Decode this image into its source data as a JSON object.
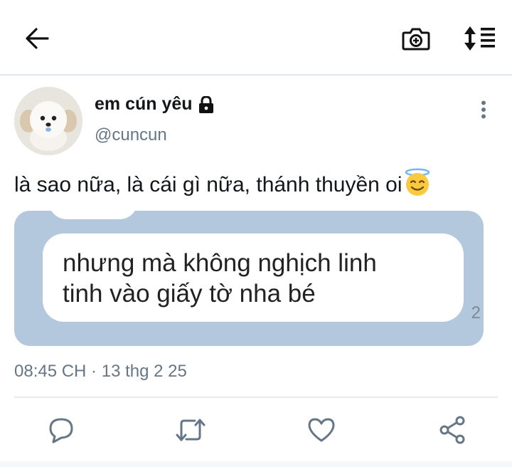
{
  "topbar": {
    "back_icon": "back-arrow-icon",
    "camera_icon": "camera-plus-icon",
    "sort_icon": "sort-list-icon"
  },
  "author": {
    "display_name": "em cún yêu",
    "handle": "@cuncun",
    "protected_icon": "lock-icon",
    "avatar_icon": "puppy-avatar"
  },
  "tweet": {
    "text": "là sao nữa, là cái gì nữa, thánh thuyền oi",
    "emoji": "smiling-face-with-halo-emoji",
    "media": {
      "bubble_line1": "nhưng mà không nghịch linh",
      "bubble_line2": "tinh vào giấy tờ nha bé",
      "count": "2"
    },
    "timestamp": "08:45 CH · 13 thg 2 25"
  },
  "actions": {
    "reply_icon": "reply-icon",
    "retweet_icon": "retweet-icon",
    "like_icon": "heart-icon",
    "share_icon": "share-icon"
  },
  "colors": {
    "icon": "#657786",
    "media_bg": "#b3c8dd",
    "text": "#14171a"
  }
}
